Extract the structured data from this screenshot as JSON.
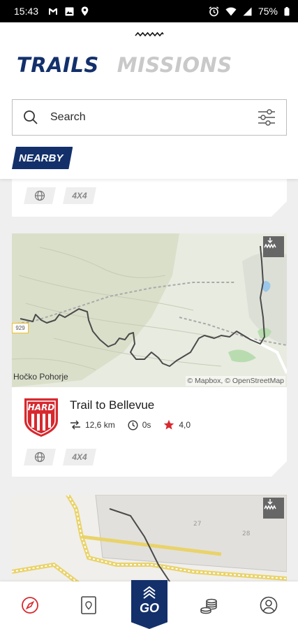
{
  "status_bar": {
    "time": "15:43",
    "left_icons": [
      "gmail-icon",
      "gallery-icon",
      "location-icon"
    ],
    "right_icons": [
      "alarm-icon",
      "wifi-icon",
      "signal-icon",
      "battery-icon"
    ],
    "battery": "75%"
  },
  "header": {
    "tabs": [
      {
        "label": "TRAILS",
        "active": true
      },
      {
        "label": "MISSIONS",
        "active": false
      }
    ],
    "search_placeholder": "Search",
    "filter_chip": "NEARBY"
  },
  "colors": {
    "brand_navy": "#13306b",
    "tab_inactive": "#c9c9c9",
    "hard_red": "#d7282e",
    "star_red": "#d7282e"
  },
  "cards": [
    {
      "partial": true,
      "tags": [
        "globe-icon",
        "4X4"
      ]
    },
    {
      "map_place": "Hočko Pohorje",
      "map_attribution": "© Mapbox, © OpenStreetMap",
      "road_number": "929",
      "difficulty": "HARD",
      "title": "Trail to Bellevue",
      "distance": "12,6 km",
      "duration": "0s",
      "rating": "4,0",
      "tags": [
        "globe-icon",
        "4X4"
      ]
    },
    {
      "partial": true,
      "map_labels": [
        "27",
        "28"
      ]
    }
  ],
  "bottom_nav": {
    "items": [
      "compass-icon",
      "map-book-icon",
      "go-button",
      "coins-icon",
      "profile-icon"
    ],
    "go_label": "GO"
  }
}
